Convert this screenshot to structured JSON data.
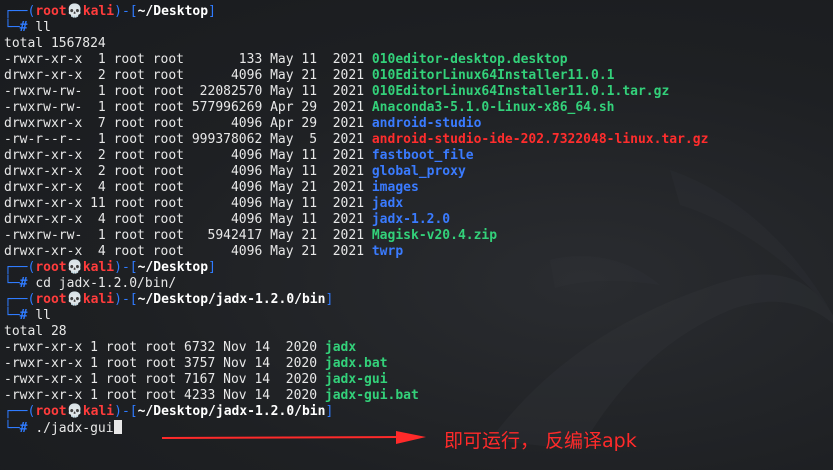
{
  "prompts": [
    {
      "user": "root",
      "host": "kali",
      "path": "~/Desktop",
      "command": "ll"
    },
    {
      "user": "root",
      "host": "kali",
      "path": "~/Desktop",
      "command": "cd jadx-1.2.0/bin/"
    },
    {
      "user": "root",
      "host": "kali",
      "path": "~/Desktop/jadx-1.2.0/bin",
      "command": "ll"
    },
    {
      "user": "root",
      "host": "kali",
      "path": "~/Desktop/jadx-1.2.0/bin",
      "command": "./jadx-gui"
    }
  ],
  "skull_glyph": "💀",
  "listing1": {
    "total": "total 1567824",
    "rows": [
      {
        "meta": "-rwxr-xr-x  1 root root       133 May 11  2021 ",
        "name": "010editor-desktop.desktop",
        "kind": "exec"
      },
      {
        "meta": "drwxr-xr-x  2 root root      4096 May 21  2021 ",
        "name": "010EditorLinux64Installer11.0.1",
        "kind": "exec"
      },
      {
        "meta": "-rwxrw-rw-  1 root root  22082570 May 11  2021 ",
        "name": "010EditorLinux64Installer11.0.1.tar.gz",
        "kind": "exec"
      },
      {
        "meta": "-rwxrw-rw-  1 root root 577996269 Apr 29  2021 ",
        "name": "Anaconda3-5.1.0-Linux-x86_64.sh",
        "kind": "exec"
      },
      {
        "meta": "drwxrwxr-x  7 root root      4096 Apr 29  2021 ",
        "name": "android-studio",
        "kind": "dir"
      },
      {
        "meta": "-rw-r--r--  1 root root 999378062 May  5  2021 ",
        "name": "android-studio-ide-202.7322048-linux.tar.gz",
        "kind": "red"
      },
      {
        "meta": "drwxr-xr-x  2 root root      4096 May 11  2021 ",
        "name": "fastboot_file",
        "kind": "dir"
      },
      {
        "meta": "drwxr-xr-x  2 root root      4096 May 11  2021 ",
        "name": "global_proxy",
        "kind": "dir"
      },
      {
        "meta": "drwxr-xr-x  4 root root      4096 May 21  2021 ",
        "name": "images",
        "kind": "dir"
      },
      {
        "meta": "drwxr-xr-x 11 root root      4096 May 11  2021 ",
        "name": "jadx",
        "kind": "dir"
      },
      {
        "meta": "drwxr-xr-x  4 root root      4096 May 11  2021 ",
        "name": "jadx-1.2.0",
        "kind": "dir"
      },
      {
        "meta": "-rwxrw-rw-  1 root root   5942417 May 21  2021 ",
        "name": "Magisk-v20.4.zip",
        "kind": "exec"
      },
      {
        "meta": "drwxr-xr-x  4 root root      4096 May 21  2021 ",
        "name": "twrp",
        "kind": "dir"
      }
    ]
  },
  "listing2": {
    "total": "total 28",
    "rows": [
      {
        "meta": "-rwxr-xr-x 1 root root 6732 Nov 14  2020 ",
        "name": "jadx",
        "kind": "exec"
      },
      {
        "meta": "-rwxr-xr-x 1 root root 3757 Nov 14  2020 ",
        "name": "jadx.bat",
        "kind": "exec"
      },
      {
        "meta": "-rwxr-xr-x 1 root root 7167 Nov 14  2020 ",
        "name": "jadx-gui",
        "kind": "exec"
      },
      {
        "meta": "-rwxr-xr-x 1 root root 4233 Nov 14  2020 ",
        "name": "jadx-gui.bat",
        "kind": "exec"
      }
    ]
  },
  "annotation": {
    "text": "即可运行， 反编译apk",
    "color": "#ff2a2a"
  },
  "colors": {
    "background": "#1b1d20",
    "prompt_frame": "#2f7bff",
    "prompt_user": "#ff3c3c",
    "exec_file": "#33d17a",
    "directory": "#3a7bff",
    "archive_red": "#ff2d2d"
  }
}
